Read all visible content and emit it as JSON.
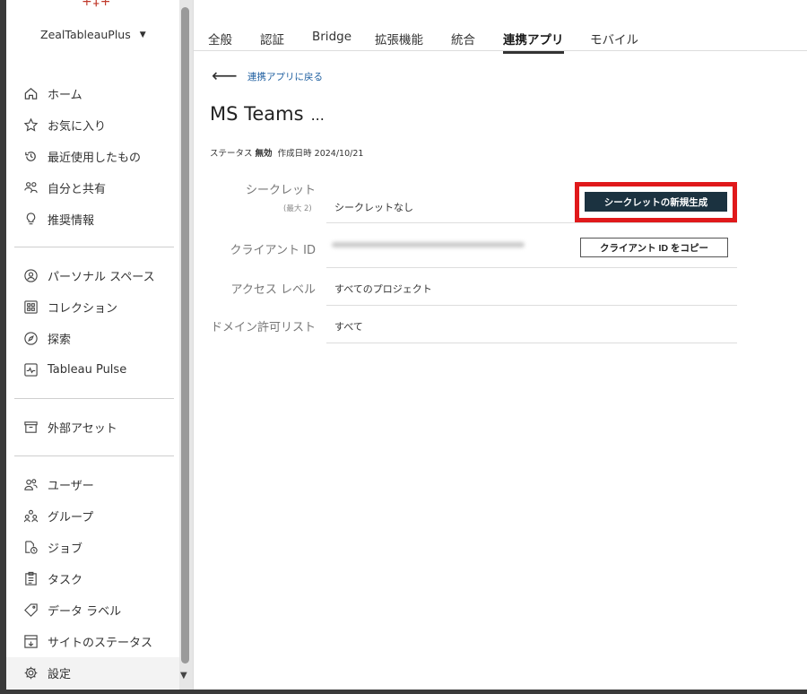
{
  "site_name": "ZealTableauPlus",
  "sidebar": {
    "group1": [
      {
        "label": "ホーム",
        "icon": "home-icon"
      },
      {
        "label": "お気に入り",
        "icon": "star-icon"
      },
      {
        "label": "最近使用したもの",
        "icon": "history-icon"
      },
      {
        "label": "自分と共有",
        "icon": "shared-icon"
      },
      {
        "label": "推奨情報",
        "icon": "lightbulb-icon"
      }
    ],
    "group2": [
      {
        "label": "パーソナル スペース",
        "icon": "personal-space-icon"
      },
      {
        "label": "コレクション",
        "icon": "collection-icon"
      },
      {
        "label": "探索",
        "icon": "compass-icon"
      },
      {
        "label": "Tableau Pulse",
        "icon": "pulse-icon"
      }
    ],
    "group3": [
      {
        "label": "外部アセット",
        "icon": "external-assets-icon"
      }
    ],
    "group4": [
      {
        "label": "ユーザー",
        "icon": "users-icon"
      },
      {
        "label": "グループ",
        "icon": "groups-icon"
      },
      {
        "label": "ジョブ",
        "icon": "jobs-icon"
      },
      {
        "label": "タスク",
        "icon": "tasks-icon"
      },
      {
        "label": "データ ラベル",
        "icon": "tag-icon"
      },
      {
        "label": "サイトのステータス",
        "icon": "site-status-icon"
      },
      {
        "label": "設定",
        "icon": "gear-icon"
      }
    ]
  },
  "tabs": [
    "全般",
    "認証",
    "Bridge",
    "拡張機能",
    "統合",
    "連携アプリ",
    "モバイル"
  ],
  "active_tab": "連携アプリ",
  "back_link": "連携アプリに戻る",
  "title": "MS Teams",
  "more": "...",
  "status": {
    "status_label": "ステータス",
    "status_value": "無効",
    "created_label": "作成日時",
    "created_value": "2024/10/21"
  },
  "rows": {
    "secret": {
      "label": "シークレット",
      "sub": "(最大 2)",
      "value": "シークレットなし",
      "button": "シークレットの新規生成"
    },
    "client_id": {
      "label": "クライアント ID",
      "button": "クライアント ID をコピー"
    },
    "access_level": {
      "label": "アクセス レベル",
      "value": "すべてのプロジェクト"
    },
    "domain": {
      "label": "ドメイン許可リスト",
      "value": "すべて"
    }
  },
  "colors": {
    "highlight": "#e0191b",
    "primary_button": "#1b3240",
    "link": "#1f5fa0"
  }
}
